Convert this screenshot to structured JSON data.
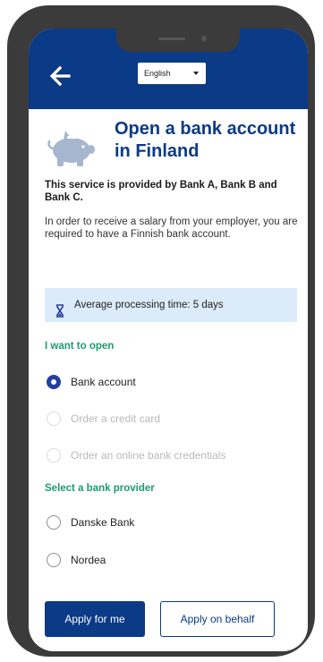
{
  "header": {
    "language": "English",
    "color": "#0b3a86"
  },
  "page": {
    "title": "Open a bank account in Finland",
    "provider_text": "This service is provided by Bank A, Bank B and Bank C.",
    "intro_text": "In order to receive a salary from your employer, you are required to have a Finnish bank account."
  },
  "notice": {
    "icon": "hourglass-icon",
    "text": "Average processing time: 5 days"
  },
  "open_section": {
    "label": "I want to open",
    "options": [
      {
        "label": "Bank account",
        "state": "selected"
      },
      {
        "label": "Order a credit card",
        "state": "disabled"
      },
      {
        "label": "Order an online bank credentials",
        "state": "disabled"
      }
    ]
  },
  "provider_section": {
    "label": "Select a bank provider",
    "options": [
      {
        "label": "Danske Bank",
        "state": "unselected"
      },
      {
        "label": "Nordea",
        "state": "unselected"
      }
    ]
  },
  "actions": {
    "primary_label": "Apply for me",
    "secondary_label": "Apply on behalf"
  }
}
